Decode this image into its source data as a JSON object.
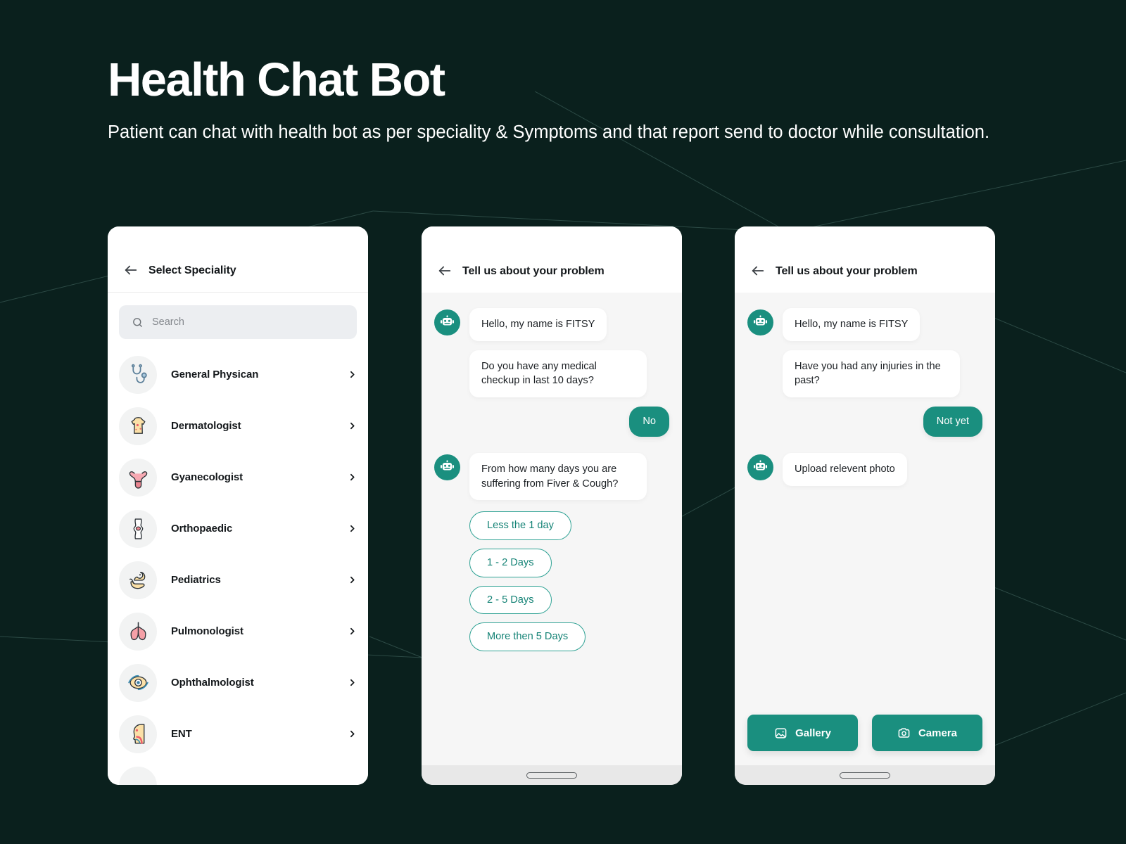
{
  "page": {
    "background_color": "#0a201d",
    "accent_color": "#1a8f7f",
    "title": "Health Chat Bot",
    "subtitle": "Patient can chat with health bot as per speciality & Symptoms and that report send to doctor while consultation."
  },
  "screen_1": {
    "header": {
      "back_icon": "arrow-left-icon",
      "title": "Select Speciality"
    },
    "search": {
      "icon": "search-icon",
      "placeholder": "Search",
      "value": ""
    },
    "items": [
      {
        "label": "General Physican",
        "icon": "stethoscope-icon",
        "chevron": "chevron-right-icon"
      },
      {
        "label": "Dermatologist",
        "icon": "skin-torso-icon",
        "chevron": "chevron-right-icon"
      },
      {
        "label": "Gyanecologist",
        "icon": "uterus-icon",
        "chevron": "chevron-right-icon"
      },
      {
        "label": "Orthopaedic",
        "icon": "knee-joint-icon",
        "chevron": "chevron-right-icon"
      },
      {
        "label": "Pediatrics",
        "icon": "baby-in-hands-icon",
        "chevron": "chevron-right-icon"
      },
      {
        "label": "Pulmonologist",
        "icon": "lungs-icon",
        "chevron": "chevron-right-icon"
      },
      {
        "label": "Ophthalmologist",
        "icon": "eye-icon",
        "chevron": "chevron-right-icon"
      },
      {
        "label": "ENT",
        "icon": "head-throat-icon",
        "chevron": "chevron-right-icon"
      }
    ]
  },
  "screen_2": {
    "header": {
      "back_icon": "arrow-left-icon",
      "title": "Tell us about your problem"
    },
    "messages": [
      {
        "from": "bot",
        "text": "Hello, my name is FITSY",
        "avatar": "robot-icon"
      },
      {
        "from": "bot",
        "text": "Do you have any medical checkup in last 10 days?"
      },
      {
        "from": "user",
        "text": "No"
      },
      {
        "from": "bot",
        "text": "From how many days you are suffering from Fiver & Cough?",
        "avatar": "robot-icon"
      }
    ],
    "options": [
      "Less the 1 day",
      "1 - 2 Days",
      "2 - 5 Days",
      "More then 5 Days"
    ]
  },
  "screen_3": {
    "header": {
      "back_icon": "arrow-left-icon",
      "title": "Tell us about your problem"
    },
    "messages": [
      {
        "from": "bot",
        "text": "Hello, my name is FITSY",
        "avatar": "robot-icon"
      },
      {
        "from": "bot",
        "text": "Have you had any injuries in the past?"
      },
      {
        "from": "user",
        "text": "Not yet"
      },
      {
        "from": "bot",
        "text": "Upload relevent photo",
        "avatar": "robot-icon"
      }
    ],
    "actions": [
      {
        "label": "Gallery",
        "icon": "image-icon"
      },
      {
        "label": "Camera",
        "icon": "camera-icon"
      }
    ]
  }
}
